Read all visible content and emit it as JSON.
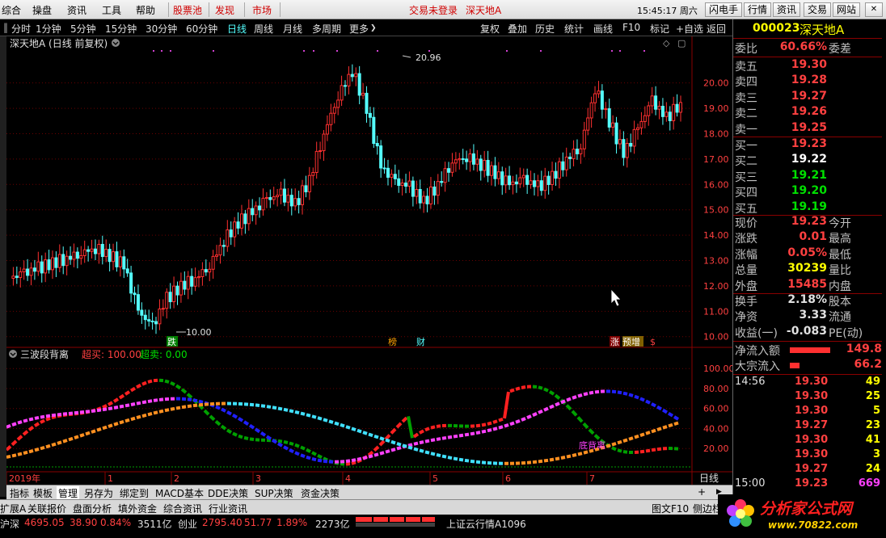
{
  "menu": {
    "items": [
      "综合",
      "操盘",
      "资讯",
      "工具",
      "帮助"
    ],
    "red_items": [
      "股票池",
      "发现",
      "市场"
    ],
    "login_status": "交易未登录",
    "stock_title": "深天地A",
    "time": "15:45:17 周六",
    "right_buttons": [
      "闪电手",
      "行情",
      "资讯",
      "交易",
      "网站"
    ]
  },
  "toolbar": {
    "periods": [
      "分时",
      "1分钟",
      "5分钟",
      "15分钟",
      "30分钟",
      "60分钟",
      "日线",
      "周线",
      "月线",
      "多周期",
      "更多"
    ],
    "active_period": "日线",
    "actions": [
      "复权",
      "叠加",
      "历史",
      "统计",
      "画线",
      "F10",
      "标记",
      "+自选",
      "返回"
    ]
  },
  "chart": {
    "header": "深天地A (日线 前复权)",
    "price_ticks": [
      "20.00",
      "19.00",
      "18.00",
      "17.00",
      "16.00",
      "15.00",
      "14.00",
      "13.00",
      "12.00",
      "11.00",
      "10.00"
    ],
    "high_label": "20.96",
    "low_label": "10.00",
    "markers": [
      "跌",
      "榜",
      "财",
      "涨",
      "预增",
      "$"
    ],
    "indicator_title": "三波段背离",
    "indicator_overbuy": "超买: 100.00",
    "indicator_oversell": "超卖: 0.00",
    "indicator_ticks": [
      "100.00",
      "80.00",
      "60.00",
      "40.00",
      "20.00"
    ],
    "divergence_label": "底背离",
    "x_labels": [
      "2019年",
      "1",
      "2",
      "3",
      "4",
      "5",
      "6",
      "7"
    ],
    "period_label": "日线"
  },
  "chart_data": {
    "type": "candlestick",
    "title": "深天地A (日线 前复权)",
    "ylim": [
      9.8,
      21.2
    ],
    "high": 20.96,
    "low": 10.0,
    "close_series_approx": [
      12.3,
      12.5,
      12.7,
      12.9,
      13.1,
      13.3,
      13.5,
      13.2,
      12.8,
      11.0,
      10.4,
      11.5,
      12.0,
      12.3,
      12.8,
      13.8,
      14.5,
      14.9,
      15.4,
      15.6,
      15.2,
      16.2,
      18.0,
      19.5,
      20.5,
      19.0,
      16.7,
      16.1,
      15.9,
      15.3,
      16.0,
      16.9,
      17.1,
      16.8,
      16.4,
      16.0,
      16.2,
      15.9,
      16.3,
      17.0,
      17.5,
      19.8,
      18.5,
      17.2,
      18.2,
      19.3,
      18.6,
      19.23
    ],
    "indicator": {
      "name": "三波段背离",
      "ylim": [
        0,
        105
      ],
      "overbuy": 100.0,
      "oversell": 0.0
    }
  },
  "quote": {
    "code": "000023",
    "name": "深天地A",
    "weibi_label": "委比",
    "weibi_value": "60.66%",
    "weicha_label": "委差",
    "asks": [
      {
        "label": "卖五",
        "price": "19.30"
      },
      {
        "label": "卖四",
        "price": "19.28"
      },
      {
        "label": "卖三",
        "price": "19.27"
      },
      {
        "label": "卖二",
        "price": "19.26"
      },
      {
        "label": "卖一",
        "price": "19.25"
      }
    ],
    "bids": [
      {
        "label": "买一",
        "price": "19.23",
        "color": "#ff4040"
      },
      {
        "label": "买二",
        "price": "19.22",
        "color": "#ffffff"
      },
      {
        "label": "买三",
        "price": "19.21",
        "color": "#00e000"
      },
      {
        "label": "买四",
        "price": "19.20",
        "color": "#00e000"
      },
      {
        "label": "买五",
        "price": "19.19",
        "color": "#00e000"
      }
    ],
    "stats": [
      {
        "label": "现价",
        "value": "19.23",
        "color": "#ff4040",
        "right": "今开"
      },
      {
        "label": "涨跌",
        "value": "0.01",
        "color": "#ff4040",
        "right": "最高"
      },
      {
        "label": "涨幅",
        "value": "0.05%",
        "color": "#ff4040",
        "right": "最低"
      },
      {
        "label": "总量",
        "value": "30239",
        "color": "#ffff00",
        "right": "量比"
      },
      {
        "label": "外盘",
        "value": "15485",
        "color": "#ff4040",
        "right": "内盘"
      }
    ],
    "stats2": [
      {
        "label": "换手",
        "value": "2.18%",
        "right": "股本"
      },
      {
        "label": "净资",
        "value": "3.33",
        "right": "流通"
      },
      {
        "label": "收益(一)",
        "value": "-0.083",
        "right": "PE(动)"
      }
    ],
    "flows": [
      {
        "label": "净流入额",
        "value": "149.8"
      },
      {
        "label": "大宗流入",
        "value": "66.2"
      }
    ],
    "ticks": [
      {
        "time": "14:56",
        "price": "19.30",
        "vol": "49"
      },
      {
        "time": "",
        "price": "19.30",
        "vol": "25"
      },
      {
        "time": "",
        "price": "19.30",
        "vol": "5"
      },
      {
        "time": "",
        "price": "19.27",
        "vol": "23"
      },
      {
        "time": "",
        "price": "19.30",
        "vol": "41"
      },
      {
        "time": "",
        "price": "19.30",
        "vol": "3"
      },
      {
        "time": "",
        "price": "19.27",
        "vol": "24"
      },
      {
        "time": "15:00",
        "price": "19.23",
        "vol": "669"
      }
    ]
  },
  "bottom_tabs": [
    "指标",
    "模板",
    "管理",
    "另存为",
    "绑定到",
    "MACD基本",
    "DDE决策",
    "SUP决策",
    "资金决策"
  ],
  "status_tabs": [
    "扩展A",
    "关联报价",
    "盘面分析",
    "填外资金",
    "综合资讯",
    "行业资讯"
  ],
  "status_right": [
    "图文F10",
    "侧边栏"
  ],
  "ticker": {
    "sh_label": "沪深",
    "sh_value": "4695.05",
    "sh_change": "38.90",
    "sh_pct": "0.84%",
    "sh_amount": "3511亿",
    "cy_label": "创业",
    "cy_value": "2795.40",
    "cy_change": "51.77",
    "cy_pct": "1.89%",
    "cy_amount": "2273亿",
    "cloud": "上证云行情A1096"
  },
  "logo": {
    "text": "分析家公式网",
    "url": "www.70822.com"
  },
  "colors": {
    "up": "#ff3030",
    "down": "#54ffff",
    "price_red": "#ff4040",
    "volume_yellow": "#ffff00",
    "green": "#00e000"
  }
}
